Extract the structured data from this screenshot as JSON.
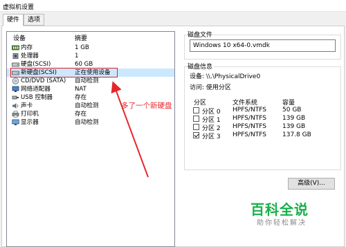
{
  "window": {
    "title": "虚拟机设置"
  },
  "tabs": [
    {
      "label": "硬件",
      "active": true
    },
    {
      "label": "选项",
      "active": false
    }
  ],
  "devices": {
    "header_device": "设备",
    "header_summary": "摘要",
    "items": [
      {
        "name": "内存",
        "summary": "1 GB",
        "icon": "memory-icon"
      },
      {
        "name": "处理器",
        "summary": "1",
        "icon": "processor-icon"
      },
      {
        "name": "硬盘(SCSI)",
        "summary": "60 GB",
        "icon": "hard-disk-icon"
      },
      {
        "name": "新硬盘(SCSI)",
        "summary": "正在使用设备",
        "icon": "hard-disk-icon",
        "selected": true
      },
      {
        "name": "CD/DVD (SATA)",
        "summary": "自动检测",
        "icon": "cd-dvd-icon"
      },
      {
        "name": "网络适配器",
        "summary": "NAT",
        "icon": "network-adapter-icon"
      },
      {
        "name": "USB 控制器",
        "summary": "存在",
        "icon": "usb-icon"
      },
      {
        "name": "声卡",
        "summary": "自动检测",
        "icon": "sound-card-icon"
      },
      {
        "name": "打印机",
        "summary": "存在",
        "icon": "printer-icon"
      },
      {
        "name": "显示器",
        "summary": "自动检测",
        "icon": "display-icon"
      }
    ]
  },
  "disk_file": {
    "label": "磁盘文件",
    "value": "Windows 10 x64-0.vmdk"
  },
  "disk_info": {
    "label": "磁盘信息",
    "device_line": "设备: \\\\.\\PhysicalDrive0",
    "access_line": "访问: 使用分区",
    "columns": [
      "分区",
      "文件系统",
      "容量"
    ],
    "partitions": [
      {
        "name": "分区 0",
        "fs": "HPFS/NTFS",
        "size": "50 GB",
        "checked": false
      },
      {
        "name": "分区 1",
        "fs": "HPFS/NTFS",
        "size": "139 GB",
        "checked": false
      },
      {
        "name": "分区 2",
        "fs": "HPFS/NTFS",
        "size": "139 GB",
        "checked": false
      },
      {
        "name": "分区 3",
        "fs": "HPFS/NTFS",
        "size": "137.8 GB",
        "checked": true
      }
    ]
  },
  "advanced_button": "高级(V)...",
  "annotation": "多了一个新硬盘",
  "watermark": {
    "title": "百科全说",
    "subtitle": "助你轻松解决"
  },
  "colors": {
    "annotation": "#e5262b",
    "watermark": "#18b04a",
    "selection": "#cce8ff"
  }
}
